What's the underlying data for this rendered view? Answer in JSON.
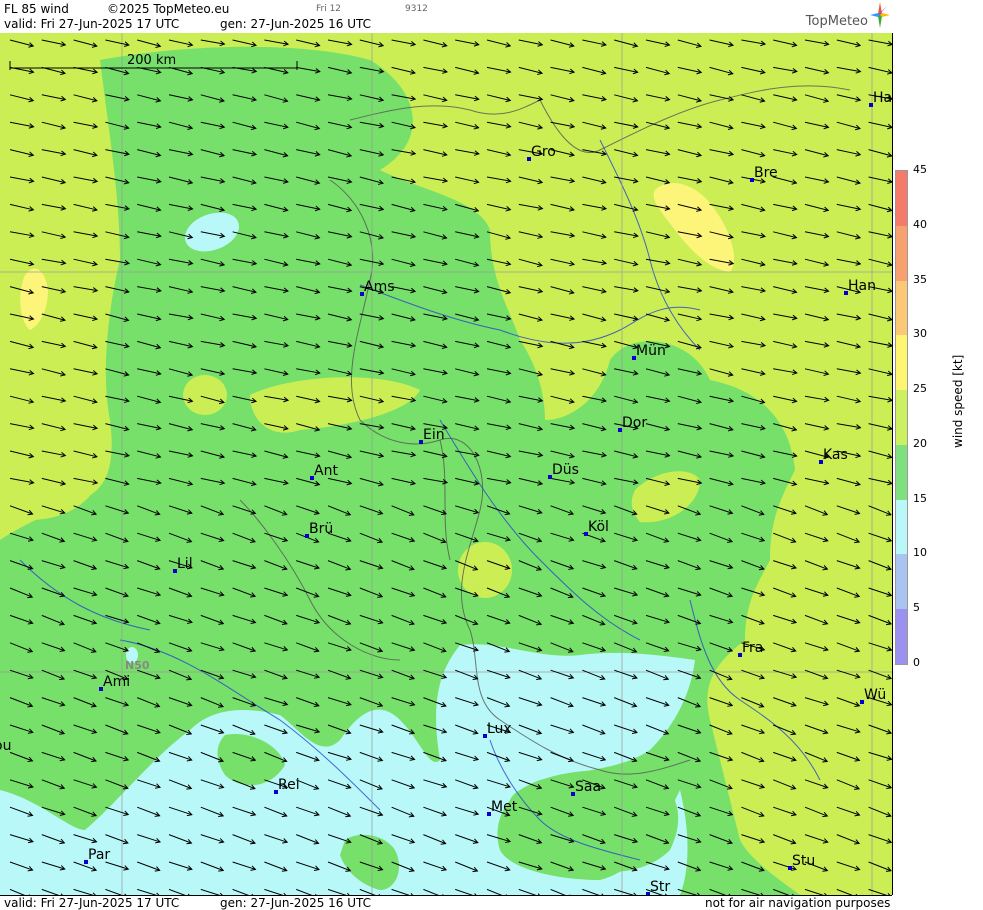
{
  "header": {
    "product": "FL 85 wind",
    "copyright": "©2025 TopMeteo.eu",
    "valid": "valid:  Fri  27-Jun-2025  17 UTC",
    "gen": "gen: 27-Jun-2025 16 UTC",
    "small_a": "Fri 12",
    "small_b": "9312",
    "logo_text": "TopMeteo"
  },
  "footer": {
    "valid": "valid:  Fri  27-Jun-2025  17 UTC",
    "gen": "gen: 27-Jun-2025 16 UTC",
    "disclaimer": "not for air navigation purposes"
  },
  "scale": {
    "label": "200 km"
  },
  "grid_label": "N50",
  "cities": [
    {
      "name": "Ha"
    },
    {
      "name": "Gro"
    },
    {
      "name": "Bre"
    },
    {
      "name": "Ams"
    },
    {
      "name": "Han"
    },
    {
      "name": "Mün"
    },
    {
      "name": "Dor"
    },
    {
      "name": "Ein"
    },
    {
      "name": "Kas"
    },
    {
      "name": "Ant"
    },
    {
      "name": "Düs"
    },
    {
      "name": "Brü"
    },
    {
      "name": "Köl"
    },
    {
      "name": "Lil"
    },
    {
      "name": "Fra"
    },
    {
      "name": "Ami"
    },
    {
      "name": "Wü"
    },
    {
      "name": "Lux"
    },
    {
      "name": "ou"
    },
    {
      "name": "Rei"
    },
    {
      "name": "Saa"
    },
    {
      "name": "Met"
    },
    {
      "name": "Par"
    },
    {
      "name": "Stu"
    },
    {
      "name": "Str"
    }
  ],
  "legend": {
    "title": "wind speed [kt]",
    "ticks": [
      "45",
      "40",
      "35",
      "30",
      "25",
      "20",
      "15",
      "10",
      "5",
      "0"
    ],
    "colors": [
      "#f47a6a",
      "#f7a070",
      "#fbc976",
      "#fef573",
      "#ccf060",
      "#7ee07e",
      "#b9f7f8",
      "#a9c4f0",
      "#9b91ee",
      "#c88ef4"
    ]
  },
  "colors": {
    "speed_5_10": "#c88ef4",
    "speed_25_30": "#ccee55",
    "speed_20_25": "#77e06a",
    "speed_15_20": "#b9f8f8",
    "speed_30_35": "#fcf57a"
  }
}
